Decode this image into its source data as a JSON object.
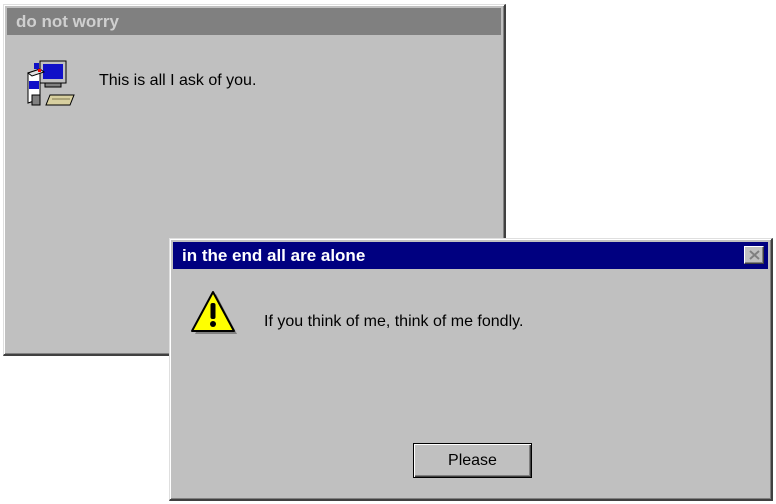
{
  "back_window": {
    "title": "do not worry",
    "message": "This is all I ask of you.",
    "icon": "computer-setup-icon"
  },
  "front_window": {
    "title": "in the end all are alone",
    "message": "If you think of me, think of me fondly.",
    "icon": "warning-icon",
    "close_icon": "close-icon",
    "button_label": "Please"
  },
  "colors": {
    "active_title": "#000080",
    "inactive_title": "#808080",
    "window_face": "#c0c0c0"
  }
}
